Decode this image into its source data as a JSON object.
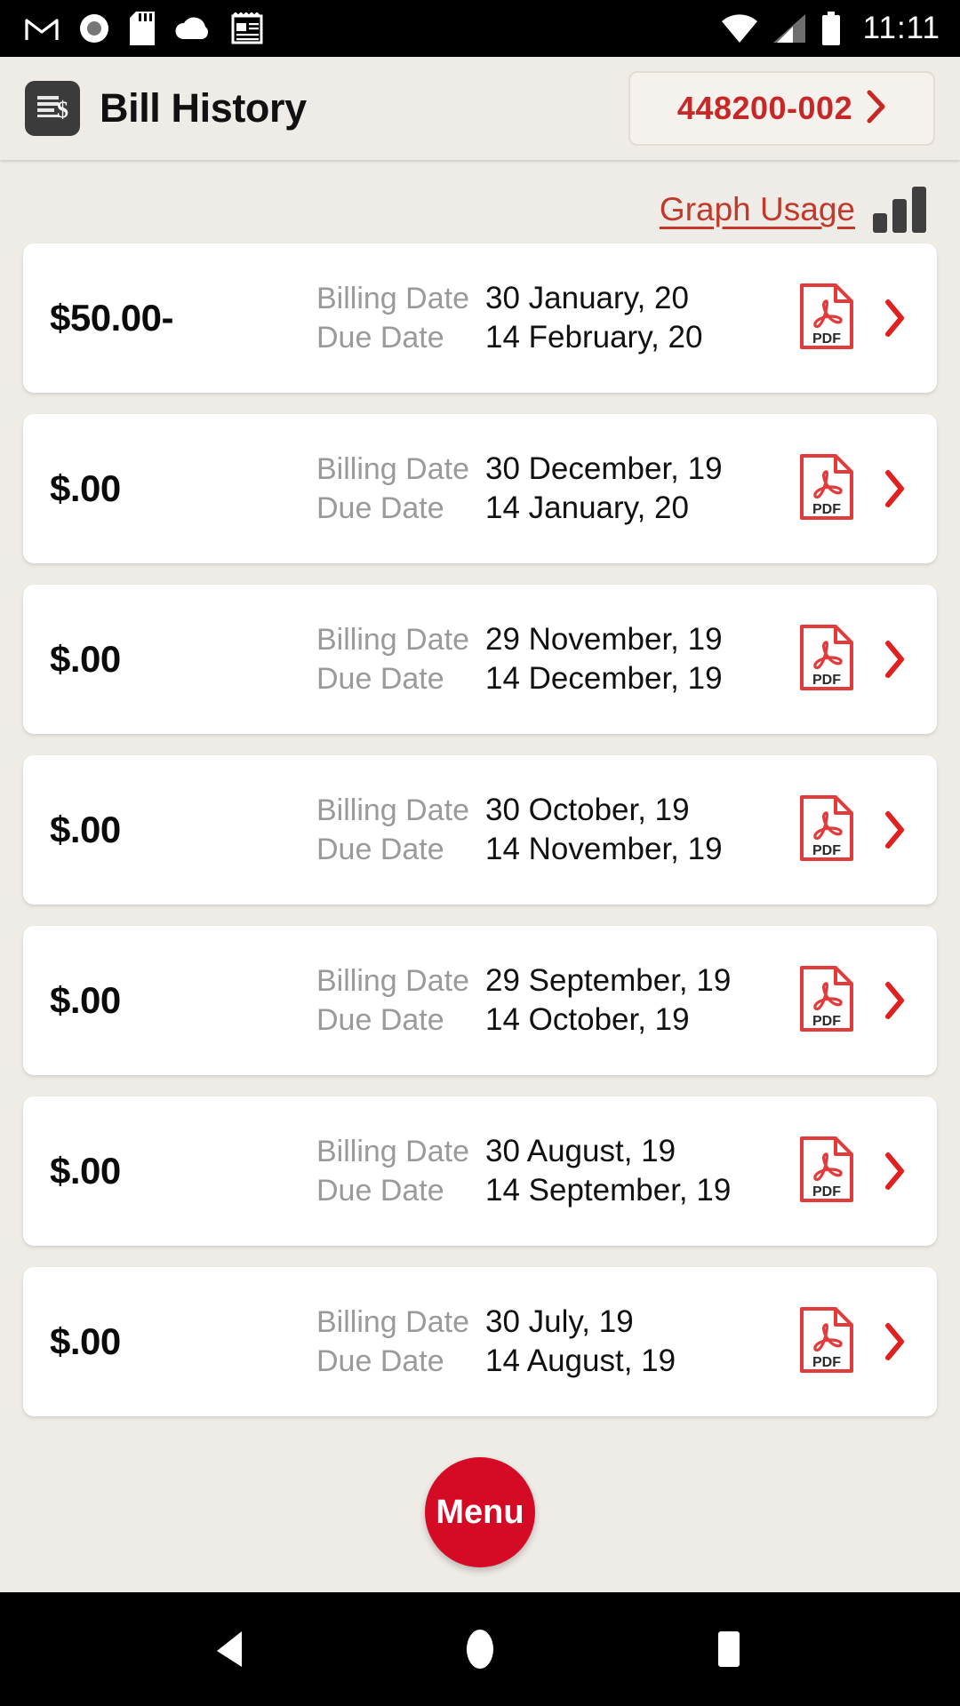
{
  "statusbar": {
    "time": "11:11",
    "left_icons": [
      "gmail-icon",
      "record-icon",
      "sd-card-icon",
      "cloud-icon",
      "notes-icon"
    ],
    "right_icons": [
      "wifi-icon",
      "cellular-signal-icon",
      "battery-icon"
    ]
  },
  "header": {
    "icon": "bill-document-icon",
    "title": "Bill History",
    "account_number": "448200-002",
    "account_chevron": "chevron-right-icon"
  },
  "usage": {
    "graph_link": "Graph Usage",
    "graph_icon": "bar-chart-icon"
  },
  "labels": {
    "billing_date": "Billing Date",
    "due_date": "Due Date",
    "pdf_icon": "pdf-file-icon",
    "row_chevron": "chevron-right-icon"
  },
  "bills": [
    {
      "amount": "$50.00-",
      "billing_date": "30 January, 20",
      "due_date": "14 February, 20"
    },
    {
      "amount": "$.00",
      "billing_date": "30 December, 19",
      "due_date": "14 January, 20"
    },
    {
      "amount": "$.00",
      "billing_date": "29 November, 19",
      "due_date": "14 December, 19"
    },
    {
      "amount": "$.00",
      "billing_date": "30 October, 19",
      "due_date": "14 November, 19"
    },
    {
      "amount": "$.00",
      "billing_date": "29 September, 19",
      "due_date": "14 October, 19"
    },
    {
      "amount": "$.00",
      "billing_date": "30 August, 19",
      "due_date": "14 September, 19"
    },
    {
      "amount": "$.00",
      "billing_date": "30 July, 19",
      "due_date": "14 August, 19"
    }
  ],
  "fab": {
    "label": "Menu"
  },
  "navbar": {
    "back": "back-triangle-icon",
    "home": "home-circle-icon",
    "recents": "recents-square-icon"
  },
  "colors": {
    "brand_red": "#C62828",
    "fab_red": "#D50A24",
    "background": "#EFEBE6",
    "card": "#FFFFFF",
    "muted_text": "#9A9A9A"
  }
}
